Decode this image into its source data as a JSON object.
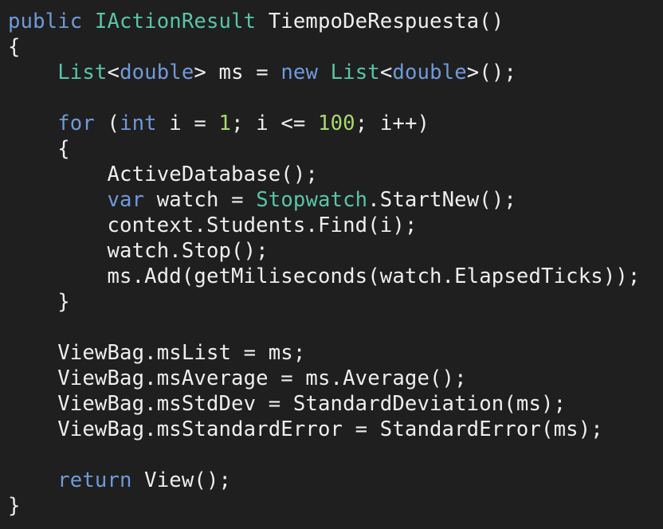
{
  "lines": [
    [
      {
        "t": "public",
        "c": "kw"
      },
      {
        "t": " ",
        "c": "plain"
      },
      {
        "t": "IActionResult",
        "c": "type"
      },
      {
        "t": " TiempoDeRespuesta()",
        "c": "plain"
      }
    ],
    [
      {
        "t": "{",
        "c": "plain"
      }
    ],
    [
      {
        "t": "    ",
        "c": "plain"
      },
      {
        "t": "List",
        "c": "type"
      },
      {
        "t": "<",
        "c": "plain"
      },
      {
        "t": "double",
        "c": "kw"
      },
      {
        "t": "> ms = ",
        "c": "plain"
      },
      {
        "t": "new",
        "c": "kw"
      },
      {
        "t": " ",
        "c": "plain"
      },
      {
        "t": "List",
        "c": "type"
      },
      {
        "t": "<",
        "c": "plain"
      },
      {
        "t": "double",
        "c": "kw"
      },
      {
        "t": ">();",
        "c": "plain"
      }
    ],
    [
      {
        "t": "",
        "c": "plain"
      }
    ],
    [
      {
        "t": "    ",
        "c": "plain"
      },
      {
        "t": "for",
        "c": "kw"
      },
      {
        "t": " (",
        "c": "plain"
      },
      {
        "t": "int",
        "c": "kw"
      },
      {
        "t": " i = ",
        "c": "plain"
      },
      {
        "t": "1",
        "c": "num"
      },
      {
        "t": "; i <= ",
        "c": "plain"
      },
      {
        "t": "100",
        "c": "num"
      },
      {
        "t": "; i++)",
        "c": "plain"
      }
    ],
    [
      {
        "t": "    {",
        "c": "plain"
      }
    ],
    [
      {
        "t": "        ActiveDatabase();",
        "c": "plain"
      }
    ],
    [
      {
        "t": "        ",
        "c": "plain"
      },
      {
        "t": "var",
        "c": "kw"
      },
      {
        "t": " watch = ",
        "c": "plain"
      },
      {
        "t": "Stopwatch",
        "c": "type"
      },
      {
        "t": ".StartNew();",
        "c": "plain"
      }
    ],
    [
      {
        "t": "        context.Students.Find(i);",
        "c": "plain"
      }
    ],
    [
      {
        "t": "        watch.Stop();",
        "c": "plain"
      }
    ],
    [
      {
        "t": "        ms.Add(getMiliseconds(watch.ElapsedTicks));",
        "c": "plain"
      }
    ],
    [
      {
        "t": "    }",
        "c": "plain"
      }
    ],
    [
      {
        "t": "",
        "c": "plain"
      }
    ],
    [
      {
        "t": "    ViewBag.msList = ms;",
        "c": "plain"
      }
    ],
    [
      {
        "t": "    ViewBag.msAverage = ms.Average();",
        "c": "plain"
      }
    ],
    [
      {
        "t": "    ViewBag.msStdDev = StandardDeviation(ms);",
        "c": "plain"
      }
    ],
    [
      {
        "t": "    ViewBag.msStandardError = StandardError(ms);",
        "c": "plain"
      }
    ],
    [
      {
        "t": "",
        "c": "plain"
      }
    ],
    [
      {
        "t": "    ",
        "c": "plain"
      },
      {
        "t": "return",
        "c": "kw"
      },
      {
        "t": " View();",
        "c": "plain"
      }
    ],
    [
      {
        "t": "}",
        "c": "plain"
      }
    ]
  ],
  "colors": {
    "background": "#1f1f20",
    "keyword": "#6e9bd8",
    "type": "#59c5a6",
    "number": "#a8d96f",
    "text": "#eeeeee"
  }
}
